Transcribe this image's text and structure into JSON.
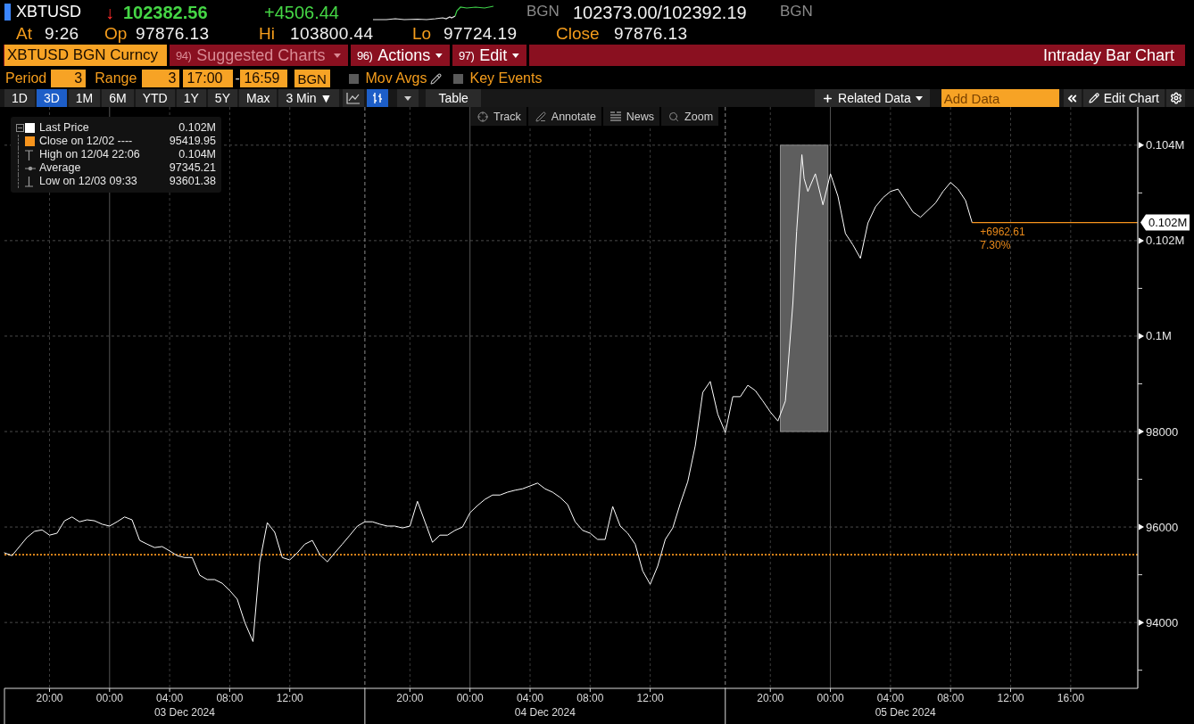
{
  "quote": {
    "ticker": "XBTUSD",
    "tick": "↓",
    "last": "102382.56",
    "change": "+4506.44",
    "source": "BGN",
    "bid_ask": "102373.00/102392.19",
    "bid_ask_source": "BGN"
  },
  "stats": [
    {
      "label": "At",
      "value": "9:26"
    },
    {
      "label": "Op",
      "value": "97876.13"
    },
    {
      "label": "Hi",
      "value": "103800.44"
    },
    {
      "label": "Lo",
      "value": "97724.19"
    },
    {
      "label": "Close",
      "value": "97876.13"
    }
  ],
  "command_bar": {
    "security": "XBTUSD BGN Curncy",
    "menus": [
      {
        "number": "94)",
        "label": "Suggested Charts",
        "disabled": true
      },
      {
        "number": "96)",
        "label": "Actions",
        "disabled": false
      },
      {
        "number": "97)",
        "label": "Edit",
        "disabled": false
      }
    ],
    "title": "Intraday Bar Chart"
  },
  "settings": {
    "period_label": "Period",
    "period": "3",
    "range_label": "Range",
    "range": "3",
    "start": "17:00",
    "dash": "-",
    "end": "16:59",
    "source": "BGN",
    "toggles": [
      {
        "label": "Mov Avgs",
        "checked": false,
        "editable": true
      },
      {
        "label": "Key Events",
        "checked": false,
        "editable": false
      }
    ]
  },
  "toolbar": {
    "ranges": [
      {
        "label": "1D",
        "selected": false
      },
      {
        "label": "3D",
        "selected": true
      },
      {
        "label": "1M",
        "selected": false
      },
      {
        "label": "6M",
        "selected": false
      },
      {
        "label": "YTD",
        "selected": false
      },
      {
        "label": "1Y",
        "selected": false
      },
      {
        "label": "5Y",
        "selected": false
      },
      {
        "label": "Max",
        "selected": false
      }
    ],
    "interval": "3 Min ▼",
    "chart_types": [
      {
        "kind": "line",
        "selected": false
      },
      {
        "kind": "bar",
        "selected": true
      }
    ],
    "table": "Table",
    "related_data": "Related Data",
    "add_data": {
      "placeholder": "Add Data"
    },
    "edit_chart": "Edit Chart"
  },
  "chart": {
    "tools": [
      {
        "kind": "track",
        "label": "Track"
      },
      {
        "kind": "annotate",
        "label": "Annotate"
      },
      {
        "kind": "news",
        "label": "News"
      },
      {
        "kind": "zoom",
        "label": "Zoom"
      }
    ],
    "legend": {
      "expanded": true,
      "items": [
        {
          "kind": "swatch",
          "color": "#ffffff",
          "label": "Last Price",
          "value": "0.102M"
        },
        {
          "kind": "swatch",
          "color": "#f7941d",
          "label": "Close on 12/02 ----",
          "value": "95419.95"
        },
        {
          "kind": "high",
          "label": "High on 12/04 22:06",
          "value": "0.104M"
        },
        {
          "kind": "average",
          "label": "Average",
          "value": "97345.21"
        },
        {
          "kind": "low",
          "label": "Low on 12/03 09:33",
          "value": "93601.38"
        }
      ]
    },
    "last_price_tag": "0.102M",
    "date_labels": [
      "03 Dec 2024",
      "04 Dec 2024",
      "05 Dec 2024"
    ],
    "chart_data": {
      "type": "line",
      "color": "#ffffff",
      "grid": true,
      "xlim": [
        "2024-12-02T17:00",
        "2024-12-05T20:28"
      ],
      "ylim": [
        92620,
        104800
      ],
      "x": [
        "2024-12-02T17:00",
        "2024-12-02T17:30",
        "2024-12-02T18:00",
        "2024-12-02T18:30",
        "2024-12-02T19:00",
        "2024-12-02T19:30",
        "2024-12-02T20:00",
        "2024-12-02T20:30",
        "2024-12-02T21:00",
        "2024-12-02T21:30",
        "2024-12-02T22:00",
        "2024-12-02T22:30",
        "2024-12-02T23:00",
        "2024-12-02T23:30",
        "2024-12-03T00:00",
        "2024-12-03T00:30",
        "2024-12-03T01:00",
        "2024-12-03T01:30",
        "2024-12-03T02:00",
        "2024-12-03T02:30",
        "2024-12-03T03:00",
        "2024-12-03T03:30",
        "2024-12-03T04:00",
        "2024-12-03T04:30",
        "2024-12-03T05:00",
        "2024-12-03T05:30",
        "2024-12-03T06:00",
        "2024-12-03T06:30",
        "2024-12-03T07:00",
        "2024-12-03T07:30",
        "2024-12-03T08:00",
        "2024-12-03T08:30",
        "2024-12-03T09:00",
        "2024-12-03T09:33",
        "2024-12-03T10:00",
        "2024-12-03T10:30",
        "2024-12-03T11:00",
        "2024-12-03T11:30",
        "2024-12-03T12:00",
        "2024-12-03T12:30",
        "2024-12-03T13:00",
        "2024-12-03T13:30",
        "2024-12-03T14:00",
        "2024-12-03T14:30",
        "2024-12-03T15:00",
        "2024-12-03T15:30",
        "2024-12-03T16:00",
        "2024-12-03T16:30",
        "2024-12-03T17:00",
        "2024-12-03T17:30",
        "2024-12-03T18:00",
        "2024-12-03T18:30",
        "2024-12-03T19:00",
        "2024-12-03T19:30",
        "2024-12-03T20:00",
        "2024-12-03T20:30",
        "2024-12-03T21:00",
        "2024-12-03T21:30",
        "2024-12-03T22:00",
        "2024-12-03T22:30",
        "2024-12-03T23:00",
        "2024-12-03T23:30",
        "2024-12-04T00:00",
        "2024-12-04T00:30",
        "2024-12-04T01:00",
        "2024-12-04T01:30",
        "2024-12-04T02:00",
        "2024-12-04T02:30",
        "2024-12-04T03:00",
        "2024-12-04T03:30",
        "2024-12-04T04:00",
        "2024-12-04T04:30",
        "2024-12-04T05:00",
        "2024-12-04T05:30",
        "2024-12-04T06:00",
        "2024-12-04T06:30",
        "2024-12-04T07:00",
        "2024-12-04T07:30",
        "2024-12-04T08:00",
        "2024-12-04T08:30",
        "2024-12-04T09:00",
        "2024-12-04T09:30",
        "2024-12-04T10:00",
        "2024-12-04T10:30",
        "2024-12-04T11:00",
        "2024-12-04T11:30",
        "2024-12-04T12:00",
        "2024-12-04T12:30",
        "2024-12-04T13:00",
        "2024-12-04T13:30",
        "2024-12-04T14:00",
        "2024-12-04T14:30",
        "2024-12-04T15:00",
        "2024-12-04T15:30",
        "2024-12-04T16:00",
        "2024-12-04T16:30",
        "2024-12-04T17:00",
        "2024-12-04T17:30",
        "2024-12-04T18:00",
        "2024-12-04T18:30",
        "2024-12-04T19:00",
        "2024-12-04T19:30",
        "2024-12-04T20:00",
        "2024-12-04T20:30",
        "2024-12-04T21:00",
        "2024-12-04T21:30",
        "2024-12-04T21:45",
        "2024-12-04T22:06",
        "2024-12-04T22:15",
        "2024-12-04T22:30",
        "2024-12-04T23:00",
        "2024-12-04T23:30",
        "2024-12-05T00:00",
        "2024-12-05T00:30",
        "2024-12-05T01:00",
        "2024-12-05T01:30",
        "2024-12-05T02:00",
        "2024-12-05T02:30",
        "2024-12-05T03:00",
        "2024-12-05T03:30",
        "2024-12-05T04:00",
        "2024-12-05T04:30",
        "2024-12-05T05:00",
        "2024-12-05T05:30",
        "2024-12-05T06:00",
        "2024-12-05T06:30",
        "2024-12-05T07:00",
        "2024-12-05T07:30",
        "2024-12-05T08:00",
        "2024-12-05T08:30",
        "2024-12-05T09:00",
        "2024-12-05T09:26"
      ],
      "values": [
        95460,
        95400,
        95590,
        95780,
        95910,
        95940,
        95830,
        95870,
        96130,
        96210,
        96110,
        96150,
        96130,
        96060,
        96020,
        96110,
        96210,
        96150,
        95720,
        95640,
        95570,
        95590,
        95500,
        95400,
        95360,
        95360,
        94990,
        94900,
        94900,
        94820,
        94670,
        94490,
        94000,
        93600,
        95270,
        96090,
        95890,
        95360,
        95310,
        95460,
        95640,
        95720,
        95420,
        95270,
        95460,
        95640,
        95830,
        96020,
        96110,
        96110,
        96060,
        96020,
        96020,
        95980,
        96020,
        96540,
        96110,
        95680,
        95830,
        95830,
        95930,
        96000,
        96300,
        96450,
        96580,
        96670,
        96670,
        96730,
        96770,
        96800,
        96860,
        96920,
        96800,
        96730,
        96620,
        96470,
        96110,
        95930,
        95870,
        95740,
        95740,
        96430,
        96020,
        95870,
        95640,
        95080,
        94800,
        95180,
        95740,
        95980,
        96490,
        96950,
        97700,
        98820,
        99050,
        98360,
        97980,
        98730,
        98730,
        98970,
        98860,
        98640,
        98410,
        98220,
        98640,
        100690,
        102190,
        103800,
        103300,
        103030,
        103400,
        102750,
        103400,
        102930,
        102150,
        101910,
        101630,
        102370,
        102710,
        102900,
        103030,
        103080,
        102840,
        102600,
        102490,
        102640,
        102790,
        103030,
        103220,
        103080,
        102840,
        102380
      ],
      "yticks": [
        {
          "value": 94000,
          "label": "94000"
        },
        {
          "value": 96000,
          "label": "96000"
        },
        {
          "value": 98000,
          "label": "98000"
        },
        {
          "value": 100000,
          "label": "0.1M"
        },
        {
          "value": 102000,
          "label": "0.102M"
        },
        {
          "value": 104000,
          "label": "0.104M"
        }
      ],
      "xticks": [
        {
          "value": "2024-12-02T20:00",
          "label": "20:00"
        },
        {
          "value": "2024-12-03T00:00",
          "label": "00:00"
        },
        {
          "value": "2024-12-03T04:00",
          "label": "04:00"
        },
        {
          "value": "2024-12-03T08:00",
          "label": "08:00"
        },
        {
          "value": "2024-12-03T12:00",
          "label": "12:00"
        },
        {
          "value": "2024-12-03T20:00",
          "label": "20:00"
        },
        {
          "value": "2024-12-04T00:00",
          "label": "00:00"
        },
        {
          "value": "2024-12-04T04:00",
          "label": "04:00"
        },
        {
          "value": "2024-12-04T08:00",
          "label": "08:00"
        },
        {
          "value": "2024-12-04T12:00",
          "label": "12:00"
        },
        {
          "value": "2024-12-04T20:00",
          "label": "20:00"
        },
        {
          "value": "2024-12-05T00:00",
          "label": "00:00"
        },
        {
          "value": "2024-12-05T04:00",
          "label": "04:00"
        },
        {
          "value": "2024-12-05T08:00",
          "label": "08:00"
        },
        {
          "value": "2024-12-05T12:00",
          "label": "12:00"
        },
        {
          "value": "2024-12-05T16:00",
          "label": "16:00"
        }
      ],
      "ref_lines": [
        {
          "axis": "y",
          "value": 95419.95,
          "color": "#f7941d",
          "line_style": "dotted"
        },
        {
          "axis": "x",
          "value": "2024-12-03T17:00",
          "color": "#8a8a8a",
          "line_style": "dashed"
        },
        {
          "axis": "x",
          "value": "2024-12-04T17:00",
          "color": "#8a8a8a",
          "line_style": "dashed"
        }
      ],
      "annotations": [
        "+6962.61",
        "7.30%"
      ]
    }
  }
}
